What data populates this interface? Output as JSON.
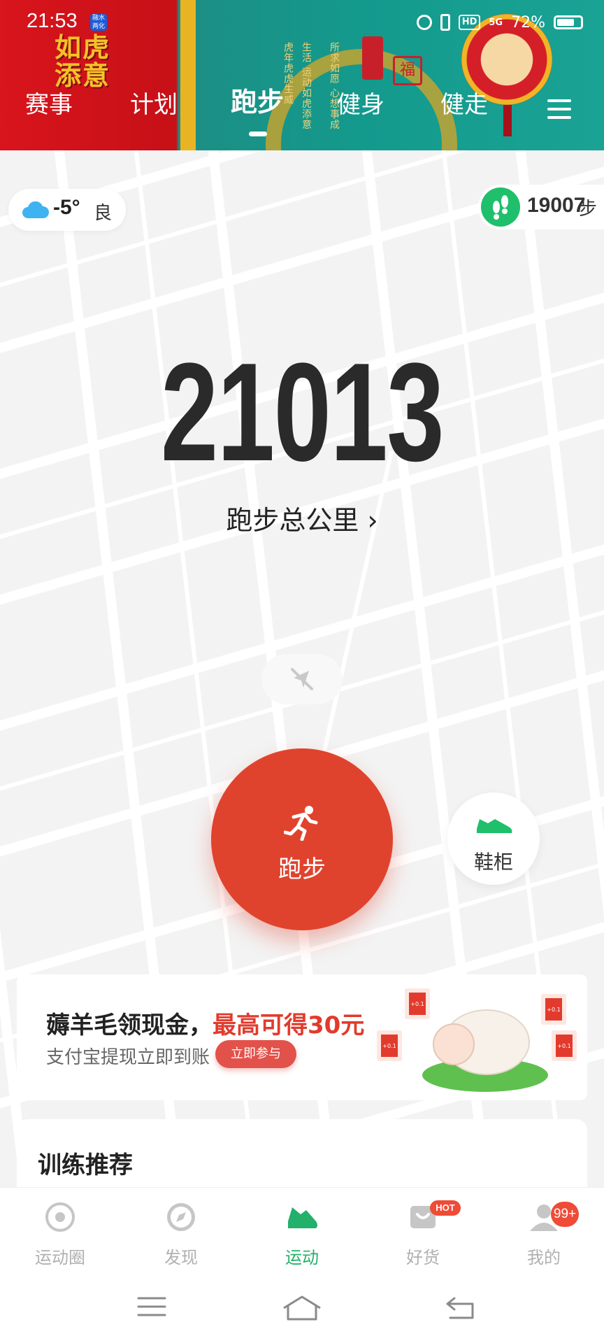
{
  "status_bar": {
    "time": "21:53",
    "app_icon_text": "融水\n两化",
    "network": "5G",
    "battery": "72%"
  },
  "banner": {
    "logo_text": "如虎\n添意",
    "poem_text": "所求如愿 心想事成",
    "poem_text2": "生活 运动如虎添意",
    "poem_text3": "虎年虎虎生威",
    "seal_char": "福"
  },
  "tabs": [
    {
      "label": "赛事",
      "active": false
    },
    {
      "label": "计划",
      "active": false
    },
    {
      "label": "跑步",
      "active": true
    },
    {
      "label": "健身",
      "active": false
    },
    {
      "label": "健走",
      "active": false
    }
  ],
  "weather": {
    "icon": "cloud-icon",
    "temperature": "-5°",
    "air_quality": "良"
  },
  "steps": {
    "icon": "footprints-icon",
    "count": "19007",
    "unit": "步"
  },
  "total_distance": {
    "value": "21013",
    "label": "跑步总公里",
    "chevron": "›"
  },
  "run_button": {
    "icon": "runner-icon",
    "label": "跑步"
  },
  "shoe_button": {
    "icon": "shoe-icon",
    "label": "鞋柜"
  },
  "promo": {
    "title": "薅羊毛领现金，",
    "highlight": "最高可得30元",
    "subtitle": "支付宝提现立即到账",
    "button": "立即参与",
    "packet_label": "+0.1"
  },
  "training": {
    "title": "训练推荐"
  },
  "bottom_nav": [
    {
      "label": "运动圈",
      "icon": "circle-icon",
      "active": false
    },
    {
      "label": "发现",
      "icon": "compass-icon",
      "active": false
    },
    {
      "label": "运动",
      "icon": "shoe-icon",
      "active": true
    },
    {
      "label": "好货",
      "icon": "shop-icon",
      "active": false,
      "badge": "HOT"
    },
    {
      "label": "我的",
      "icon": "profile-icon",
      "active": false,
      "badge": "99+"
    }
  ],
  "colors": {
    "accent_green": "#23b06a",
    "run_red": "#e0432d",
    "badge_red": "#ef4b36"
  }
}
